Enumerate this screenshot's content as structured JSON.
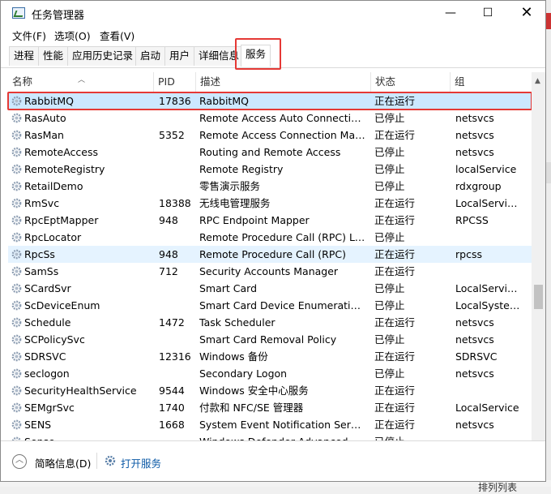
{
  "window": {
    "title": "任务管理器",
    "controls": {
      "minimize": "—",
      "maximize": "☐",
      "close": "✕"
    }
  },
  "menu": [
    "文件(F)",
    "选项(O)",
    "查看(V)"
  ],
  "tabs": [
    "进程",
    "性能",
    "应用历史记录",
    "启动",
    "用户",
    "详细信息",
    "服务"
  ],
  "active_tab": "服务",
  "columns": {
    "name": "名称",
    "pid": "PID",
    "desc": "描述",
    "status": "状态",
    "group": "组"
  },
  "rows": [
    {
      "name": "RabbitMQ",
      "pid": "17836",
      "desc": "RabbitMQ",
      "status": "正在运行",
      "group": ""
    },
    {
      "name": "RasAuto",
      "pid": "",
      "desc": "Remote Access Auto Connection ...",
      "status": "已停止",
      "group": "netsvcs"
    },
    {
      "name": "RasMan",
      "pid": "5352",
      "desc": "Remote Access Connection Man...",
      "status": "正在运行",
      "group": "netsvcs"
    },
    {
      "name": "RemoteAccess",
      "pid": "",
      "desc": "Routing and Remote Access",
      "status": "已停止",
      "group": "netsvcs"
    },
    {
      "name": "RemoteRegistry",
      "pid": "",
      "desc": "Remote Registry",
      "status": "已停止",
      "group": "localService"
    },
    {
      "name": "RetailDemo",
      "pid": "",
      "desc": "零售演示服务",
      "status": "已停止",
      "group": "rdxgroup"
    },
    {
      "name": "RmSvc",
      "pid": "18388",
      "desc": "无线电管理服务",
      "status": "正在运行",
      "group": "LocalService..."
    },
    {
      "name": "RpcEptMapper",
      "pid": "948",
      "desc": "RPC Endpoint Mapper",
      "status": "正在运行",
      "group": "RPCSS"
    },
    {
      "name": "RpcLocator",
      "pid": "",
      "desc": "Remote Procedure Call (RPC) Loc...",
      "status": "已停止",
      "group": ""
    },
    {
      "name": "RpcSs",
      "pid": "948",
      "desc": "Remote Procedure Call (RPC)",
      "status": "正在运行",
      "group": "rpcss"
    },
    {
      "name": "SamSs",
      "pid": "712",
      "desc": "Security Accounts Manager",
      "status": "正在运行",
      "group": ""
    },
    {
      "name": "SCardSvr",
      "pid": "",
      "desc": "Smart Card",
      "status": "已停止",
      "group": "LocalService..."
    },
    {
      "name": "ScDeviceEnum",
      "pid": "",
      "desc": "Smart Card Device Enumeration ...",
      "status": "已停止",
      "group": "LocalSystem..."
    },
    {
      "name": "Schedule",
      "pid": "1472",
      "desc": "Task Scheduler",
      "status": "正在运行",
      "group": "netsvcs"
    },
    {
      "name": "SCPolicySvc",
      "pid": "",
      "desc": "Smart Card Removal Policy",
      "status": "已停止",
      "group": "netsvcs"
    },
    {
      "name": "SDRSVC",
      "pid": "12316",
      "desc": "Windows 备份",
      "status": "正在运行",
      "group": "SDRSVC"
    },
    {
      "name": "seclogon",
      "pid": "",
      "desc": "Secondary Logon",
      "status": "已停止",
      "group": "netsvcs"
    },
    {
      "name": "SecurityHealthService",
      "pid": "9544",
      "desc": "Windows 安全中心服务",
      "status": "正在运行",
      "group": ""
    },
    {
      "name": "SEMgrSvc",
      "pid": "1740",
      "desc": "付款和 NFC/SE 管理器",
      "status": "正在运行",
      "group": "LocalService"
    },
    {
      "name": "SENS",
      "pid": "1668",
      "desc": "System Event Notification Service",
      "status": "正在运行",
      "group": "netsvcs"
    },
    {
      "name": "Sense",
      "pid": "",
      "desc": "Windows Defender Advanced Th...",
      "status": "已停止",
      "group": ""
    }
  ],
  "footer": {
    "collapse_icon": "︿",
    "brief": "简略信息(D)",
    "open_services": "打开服务"
  },
  "background_text": "排列列表",
  "colors": {
    "selection": "#cce8ff",
    "hover": "#e5f3ff",
    "highlight_box": "#e53935",
    "link": "#0b59a6"
  }
}
